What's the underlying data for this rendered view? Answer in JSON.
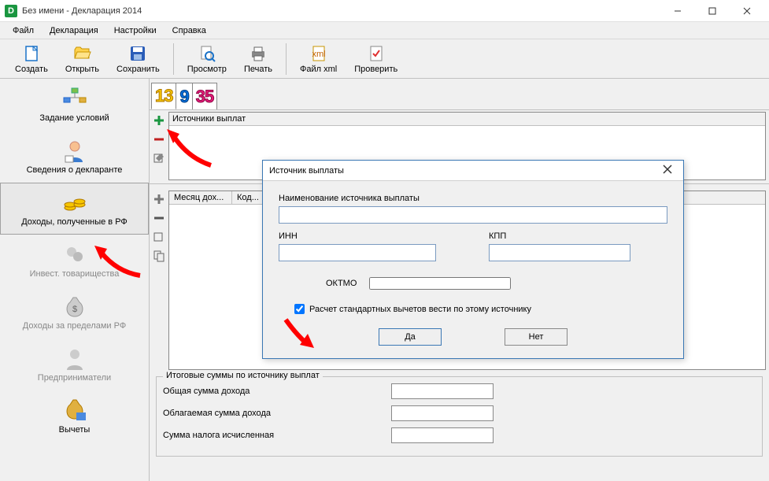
{
  "window": {
    "title": "Без имени - Декларация 2014",
    "icon_letter": "D"
  },
  "menu": {
    "file": "Файл",
    "decl": "Декларация",
    "settings": "Настройки",
    "help": "Справка"
  },
  "toolbar": {
    "create": "Создать",
    "open": "Открыть",
    "save": "Сохранить",
    "preview": "Просмотр",
    "print": "Печать",
    "xml": "Файл xml",
    "check": "Проверить"
  },
  "sidebar": {
    "conditions": "Задание условий",
    "declarant": "Сведения о декларанте",
    "income_rf": "Доходы, полученные в РФ",
    "invest": "Инвест. товарищества",
    "income_foreign": "Доходы за пределами РФ",
    "entrepreneurs": "Предприниматели",
    "deductions": "Вычеты"
  },
  "tax_tabs": {
    "t13": "13",
    "t9": "9",
    "t35": "35"
  },
  "sources": {
    "header": "Источники выплат"
  },
  "months": {
    "col_month": "Месяц дох...",
    "col_code": "Код..."
  },
  "totals": {
    "legend": "Итоговые суммы по источнику выплат",
    "total_income": "Общая сумма дохода",
    "taxable_income": "Облагаемая сумма дохода",
    "tax_calc": "Сумма налога исчисленная"
  },
  "dialog": {
    "title": "Источник выплаты",
    "name_label": "Наименование источника выплаты",
    "inn": "ИНН",
    "kpp": "КПП",
    "oktmo": "ОКТМО",
    "checkbox": "Расчет стандартных вычетов вести по этому источнику",
    "yes": "Да",
    "no": "Нет",
    "name_value": "",
    "inn_value": "",
    "kpp_value": "",
    "oktmo_value": "",
    "checkbox_checked": true
  }
}
